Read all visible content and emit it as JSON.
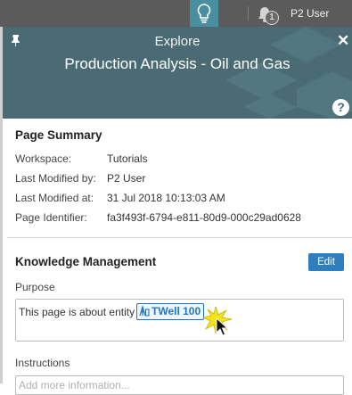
{
  "topbar": {
    "user_label": "P2 User",
    "notification_count": "1",
    "icons": [
      "lightbulb-icon",
      "bell-icon"
    ],
    "accent": "#4a8f9f"
  },
  "header": {
    "subtitle": "Explore",
    "title": "Production Analysis - Oil and Gas",
    "help_label": "?",
    "close_label": "✕",
    "background": "#4a6b74"
  },
  "page_summary": {
    "title": "Page Summary",
    "rows": [
      {
        "label": "Workspace:",
        "value": "Tutorials"
      },
      {
        "label": "Last Modified by:",
        "value": "P2 User"
      },
      {
        "label": "Last Modified at:",
        "value": "31 Jul 2018 10:13:03 AM"
      },
      {
        "label": "Page Identifier:",
        "value": "fa3f493f-6794-e811-80d9-000c29ad0628"
      }
    ]
  },
  "knowledge": {
    "title": "Knowledge Management",
    "edit_label": "Edit",
    "purpose_label": "Purpose",
    "purpose_text": "This page is about entity",
    "entity_label": "TWell 100",
    "instructions_label": "Instructions",
    "instructions_placeholder": "Add more information..."
  }
}
